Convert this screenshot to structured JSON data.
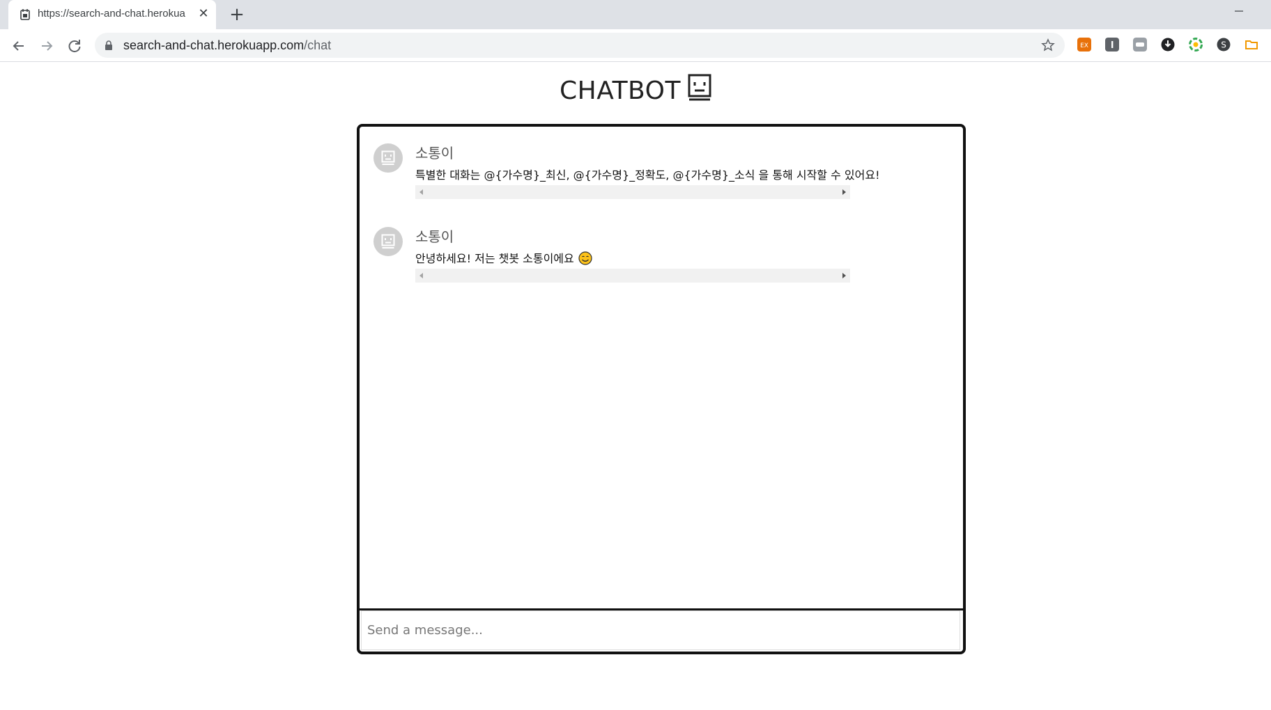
{
  "browser": {
    "tab_title": "https://search-and-chat.herokua",
    "close_glyph": "✕",
    "new_tab_glyph": "+",
    "url_host": "search-and-chat.herokuapp.com",
    "url_path": "/chat",
    "extension_icons": [
      "ex-extension-icon",
      "info-extension-icon",
      "gray-extension-icon",
      "download-extension-icon",
      "color-extension-icon",
      "s-extension-icon",
      "folder-extension-icon"
    ],
    "extension_colors": [
      "#e8710a",
      "#5f6368",
      "#9aa0a6",
      "#3c4043",
      "#34a853",
      "#5f6368",
      "#f29900"
    ]
  },
  "page": {
    "title": "CHATBOT"
  },
  "chat": {
    "messages": [
      {
        "sender": "소통이",
        "text": "특별한 대화는 @{가수명}_최신, @{가수명}_정확도, @{가수명}_소식 을 통해 시작할 수 있어요!"
      },
      {
        "sender": "소통이",
        "text": "안녕하세요! 저는 챗봇 소통이에요",
        "emoji": "smiling-face-icon"
      }
    ],
    "input_placeholder": "Send a message..."
  }
}
